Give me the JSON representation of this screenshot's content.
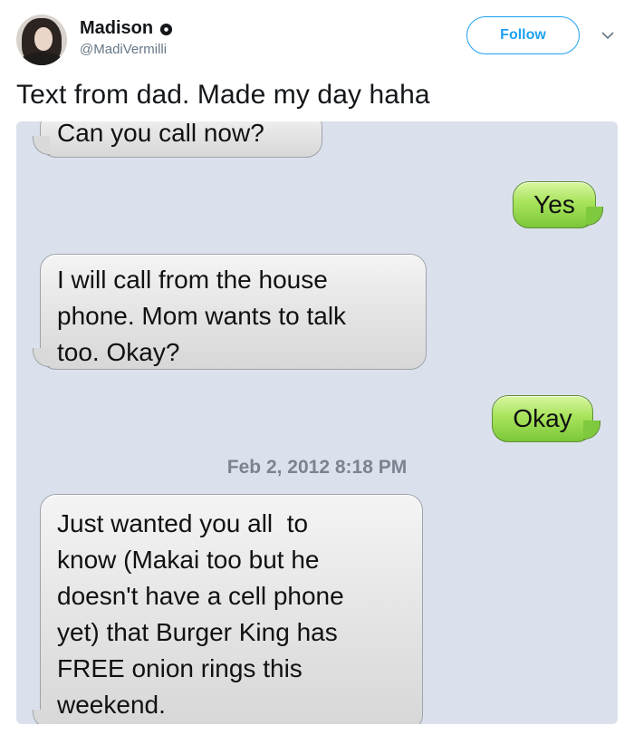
{
  "tweet": {
    "author": {
      "name": "Madison",
      "handle": "@MadiVermilli",
      "verified_icon": "badge-icon"
    },
    "follow_label": "Follow",
    "menu_icon": "chevron-down-icon",
    "text": "Text from dad. Made my day haha"
  },
  "sms": {
    "messages": [
      {
        "from": "dad",
        "text": "Can you call now?"
      },
      {
        "from": "me",
        "text": "Yes"
      },
      {
        "from": "dad",
        "lines": [
          "I will call from the house",
          "phone. Mom wants to talk",
          "too. Okay?"
        ]
      },
      {
        "from": "me",
        "text": "Okay"
      },
      {
        "from": "dad",
        "lines": [
          "Just wanted you all  to",
          "know (Makai too but he",
          "doesn't have a cell phone",
          "yet) that Burger King has",
          "FREE onion rings this",
          "weekend."
        ]
      }
    ],
    "timestamp": "Feb 2, 2012 8:18 PM"
  },
  "colors": {
    "follow_blue": "#1da1f2",
    "sms_background": "#dbe1ec",
    "incoming_bubble": "#e6e6e6",
    "outgoing_bubble": "#a8e35b"
  }
}
